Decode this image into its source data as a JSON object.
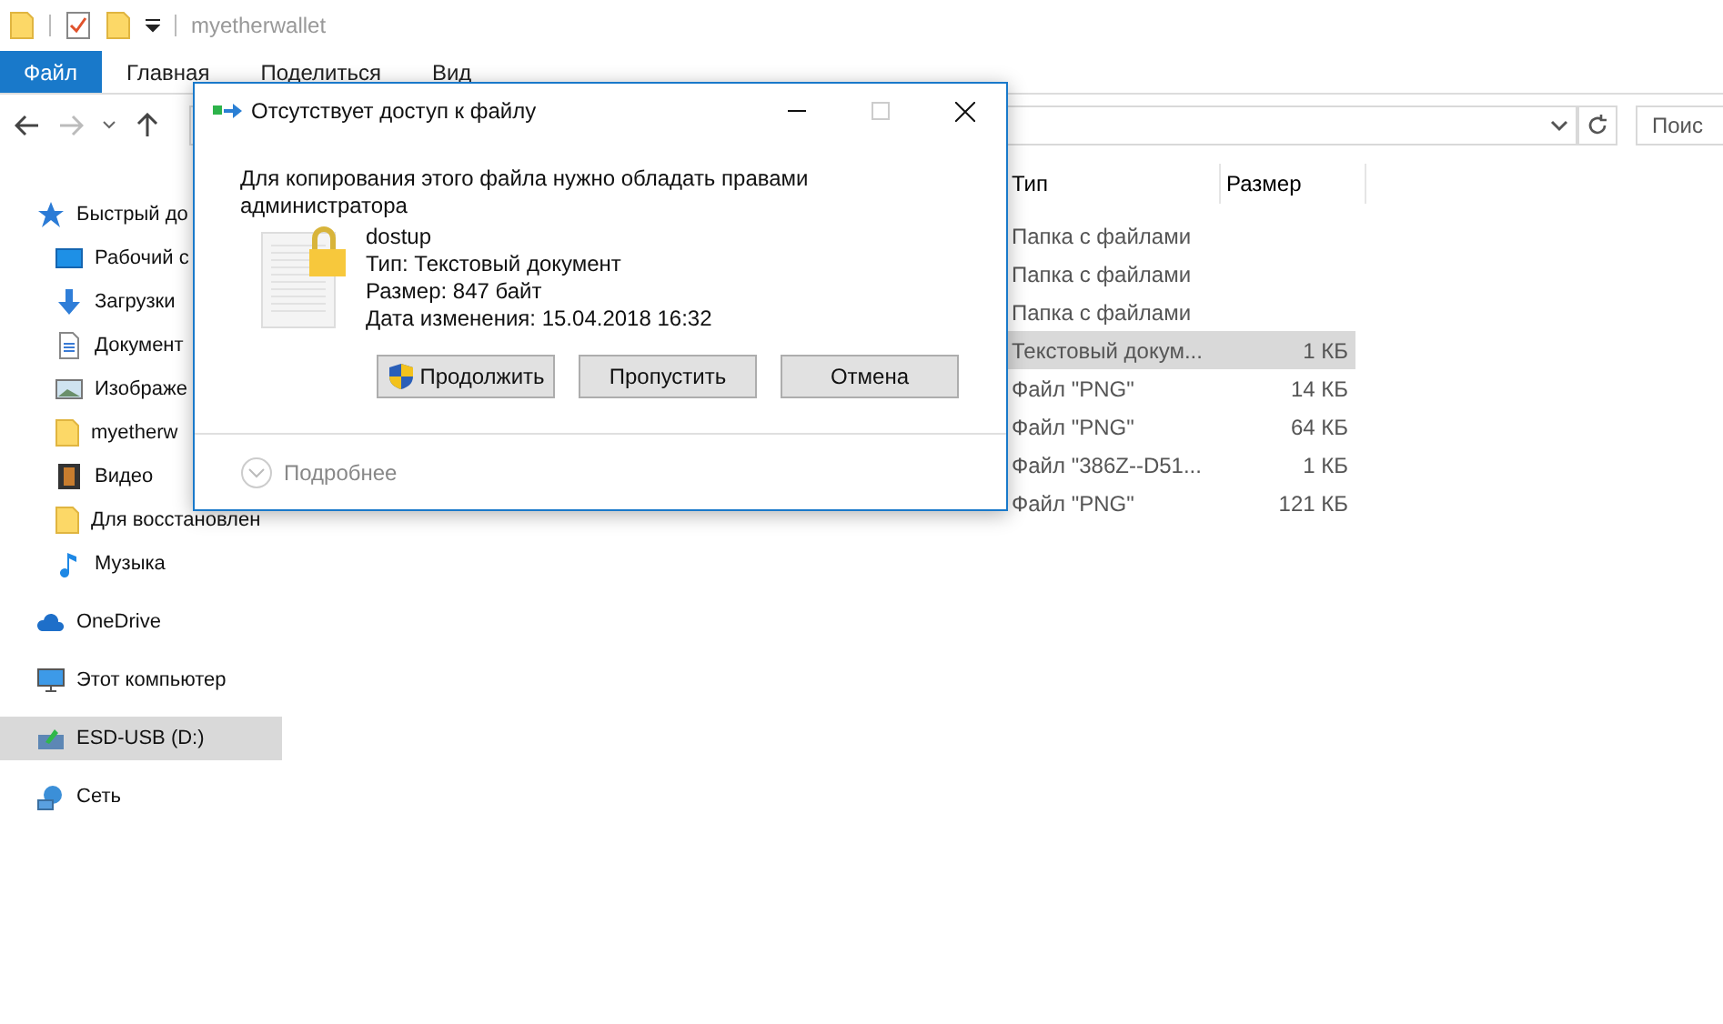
{
  "window": {
    "title": "myetherwallet"
  },
  "ribbon": {
    "file_button": "Файл",
    "tabs": [
      "Главная",
      "Поделиться",
      "Вид"
    ]
  },
  "search": {
    "placeholder": "Поис"
  },
  "sidebar": {
    "items": [
      {
        "label": "Быстрый до",
        "kind": "star",
        "selected": false,
        "children": [
          {
            "label": "Рабочий с",
            "kind": "desktop",
            "selected": false
          },
          {
            "label": "Загрузки",
            "kind": "download",
            "selected": false
          },
          {
            "label": "Документ",
            "kind": "document",
            "selected": false
          },
          {
            "label": "Изображе",
            "kind": "image",
            "selected": false
          },
          {
            "label": "myetherw",
            "kind": "folder",
            "selected": false
          },
          {
            "label": "Видео",
            "kind": "film",
            "selected": false
          },
          {
            "label": "Для восстановлен",
            "kind": "folder",
            "selected": false
          },
          {
            "label": "Музыка",
            "kind": "music",
            "selected": false
          }
        ]
      },
      {
        "label": "OneDrive",
        "kind": "cloud",
        "selected": false
      },
      {
        "label": "Этот компьютер",
        "kind": "computer",
        "selected": false
      },
      {
        "label": "ESD-USB (D:)",
        "kind": "drive",
        "selected": true
      },
      {
        "label": "Сеть",
        "kind": "network",
        "selected": false
      }
    ]
  },
  "table": {
    "columns": [
      "Тип",
      "Размер"
    ],
    "rows": [
      {
        "type": "Папка с файлами",
        "selected": false
      },
      {
        "type": "Папка с файлами",
        "selected": false
      },
      {
        "type": "Папка с файлами",
        "selected": false
      },
      {
        "type": "Текстовый докум...",
        "size": "1 КБ",
        "selected": true
      },
      {
        "type": "Файл \"PNG\"",
        "size": "14 КБ",
        "selected": false
      },
      {
        "type": "Файл \"PNG\"",
        "size": "64 КБ",
        "selected": false
      },
      {
        "type": "Файл \"386Z--D51...",
        "size": "1 КБ",
        "selected": false
      },
      {
        "type": "Файл \"PNG\"",
        "size": "121 КБ",
        "selected": false
      }
    ]
  },
  "dialog": {
    "title": "Отсутствует доступ к файлу",
    "message": "Для копирования этого файла нужно обладать правами администратора",
    "file": {
      "name": "dostup",
      "type": "Тип: Текстовый документ",
      "size": "Размер: 847 байт",
      "modified": "Дата изменения: 15.04.2018 16:32"
    },
    "buttons": [
      {
        "label": "Продолжить",
        "kind": "shield"
      },
      {
        "label": "Пропустить",
        "kind": "plain"
      },
      {
        "label": "Отмена",
        "kind": "plain"
      }
    ],
    "details": "Подробнее"
  }
}
